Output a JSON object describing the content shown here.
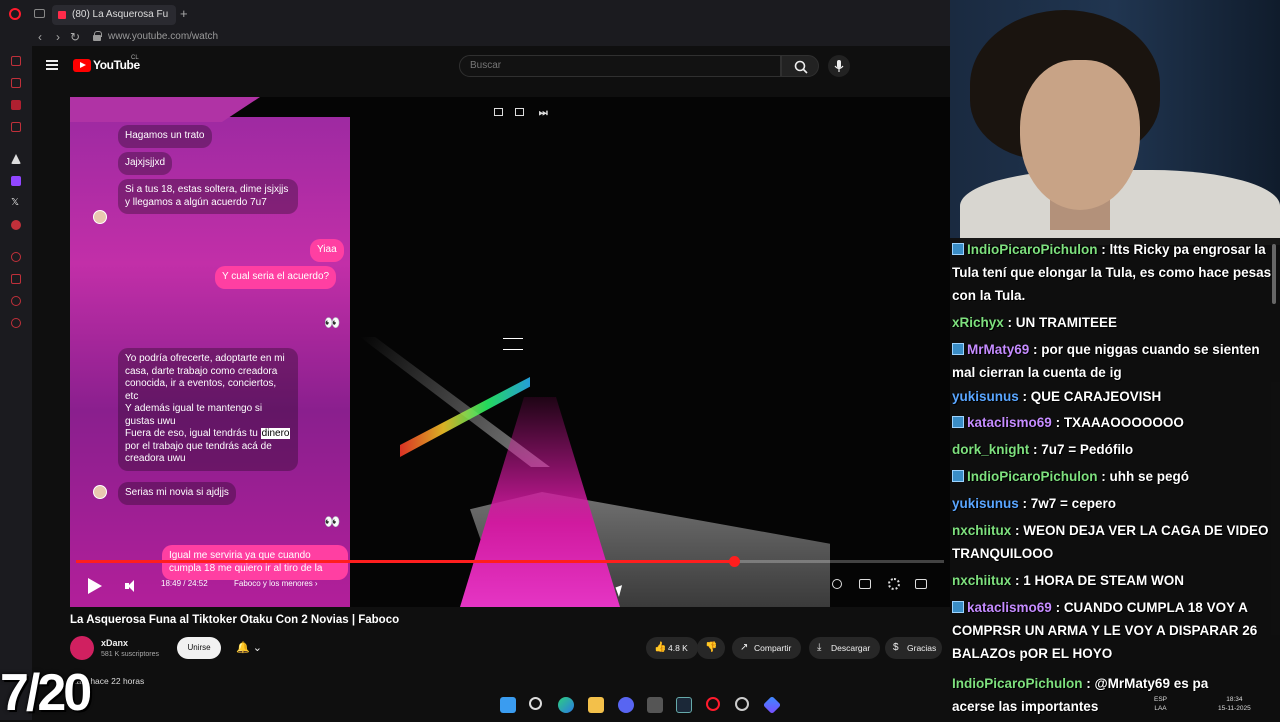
{
  "browser": {
    "tab_title": "(80) La Asquerosa Fu",
    "new_tab": "+",
    "url": "www.youtube.com/watch"
  },
  "youtube": {
    "logo": "YouTube",
    "country": "CL",
    "search_placeholder": "Buscar"
  },
  "video": {
    "chat_bubbles": [
      "Hagamos un trato",
      "Jajxjsjjxd",
      "Si a tus 18, estas soltera, dime jsjxjjs y llegamos a algún acuerdo 7u7",
      "Yiaa",
      "Y cual seria el acuerdo?",
      "Yo podría ofrecerte, adoptarte en mi casa, darte trabajo como creadora conocida, ir a eventos, conciertos, etc\nY además igual te mantengo si gustas uwu\nFuera de eso, igual tendrás tu",
      "dinero",
      " por el trabajo que tendrás acá de creadora uwu",
      "Serias mi novia si ajdjjs",
      "Igual me serviria ya que cuando cumpla 18 me quiero ir al tiro de la"
    ],
    "eyes": "👀",
    "time": "18:49 / 24:52",
    "chapter": "Faboco y los menores ›",
    "progress": 0.7575
  },
  "below_video": {
    "title": "La Asquerosa Funa al Tiktoker Otaku Con 2 Novias | Faboco",
    "channel": "xDanx",
    "subscribers": "581 K suscriptores",
    "join": "Unirse",
    "likes": "4.8 K",
    "share": "Compartir",
    "download": "Descargar",
    "thanks": "Gracias",
    "meta_views": "stas",
    "meta_age": "hace 22 horas"
  },
  "overlay": {
    "counter": "7/20"
  },
  "stream_chat": [
    {
      "user": "IndioPicaroPichulon",
      "color": "#7ee07e",
      "text": "ltts Ricky pa engrosar la Tula tení que elongar la Tula, es como hace pesas con la Tula.",
      "badge": true
    },
    {
      "user": "xRichyx",
      "color": "#7ee07e",
      "text": "UN TRAMITEEE",
      "badge": false
    },
    {
      "user": "MrMaty69",
      "color": "#c58cff",
      "text": "por que niggas cuando se sienten mal cierran la cuenta de ig",
      "badge": true
    },
    {
      "user": "yukisunus",
      "color": "#5aa6ff",
      "text": "QUE CARAJEOVISH",
      "badge": false
    },
    {
      "user": "kataclismo69",
      "color": "#c58cff",
      "text": "TXAAAOOOOOOO",
      "badge": true
    },
    {
      "user": "dork_knight",
      "color": "#7ee07e",
      "text": "7u7 = Pedófilo",
      "badge": false
    },
    {
      "user": "IndioPicaroPichulon",
      "color": "#7ee07e",
      "text": "uhh se pegó",
      "badge": true
    },
    {
      "user": "yukisunus",
      "color": "#5aa6ff",
      "text": "7w7 = cepero",
      "badge": false
    },
    {
      "user": "nxchiitux",
      "color": "#7ee07e",
      "text": "WEON DEJA VER LA CAGA DE VIDEO TRANQUILOOO",
      "badge": false
    },
    {
      "user": "nxchiitux",
      "color": "#7ee07e",
      "text": "1 HORA DE STEAM WON",
      "badge": false
    },
    {
      "user": "kataclismo69",
      "color": "#c58cff",
      "text": "CUANDO CUMPLA 18 VOY A COMPRSR UN ARMA Y LE VOY A DISPARAR 26 BALAZOs pOR EL HOYO",
      "badge": true
    },
    {
      "user": "IndioPicaroPichulon",
      "color": "#7ee07e",
      "text": "@MrMaty69 es pa",
      "badge": false
    },
    {
      "user": "",
      "color": "#ffffff",
      "text": "acerse las importantes",
      "badge": false
    }
  ],
  "taskbar": {
    "lang_top": "ESP",
    "lang_bottom": "LAA",
    "time": "18:34",
    "date": "15-11-2025"
  },
  "colors": {
    "accent": "#ff0000",
    "pink": "#ff3fa2"
  }
}
